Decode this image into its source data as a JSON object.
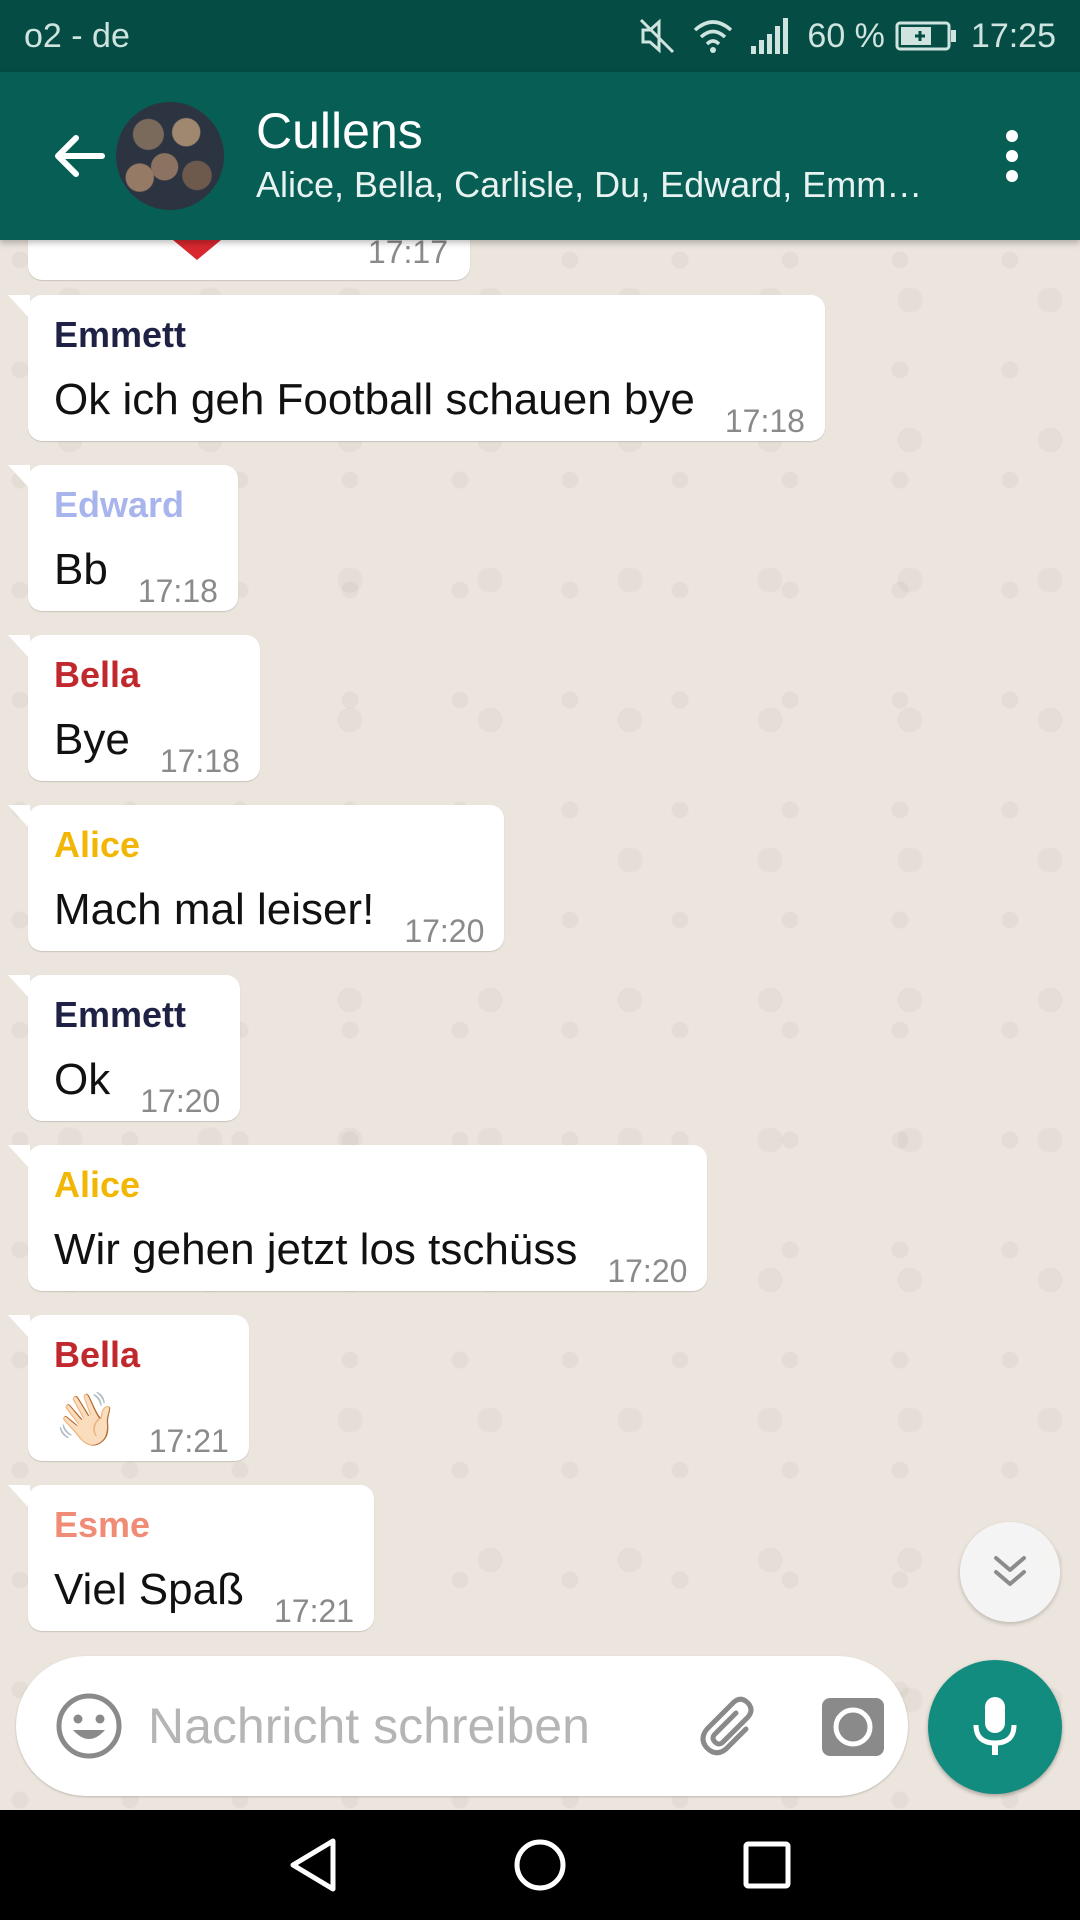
{
  "status_bar": {
    "carrier": "o2 - de",
    "battery": "60 %",
    "time": "17:25"
  },
  "header": {
    "title": "Cullens",
    "members": "Alice, Bella, Carlisle, Du, Edward, Emm…"
  },
  "chat": {
    "partial_time": "17:17",
    "messages": [
      {
        "sender": "Emmett",
        "color": "#1f2244",
        "text": "Ok ich geh Football schauen bye",
        "time": "17:18"
      },
      {
        "sender": "Edward",
        "color": "#a8b4ec",
        "text": "Bb",
        "time": "17:18"
      },
      {
        "sender": "Bella",
        "color": "#c0282e",
        "text": "Bye",
        "time": "17:18"
      },
      {
        "sender": "Alice",
        "color": "#f2b705",
        "text": "Mach mal leiser!",
        "time": "17:20"
      },
      {
        "sender": "Emmett",
        "color": "#1f2244",
        "text": "Ok",
        "time": "17:20"
      },
      {
        "sender": "Alice",
        "color": "#f2b705",
        "text": "Wir gehen jetzt los tschüss",
        "time": "17:20"
      },
      {
        "sender": "Bella",
        "color": "#c0282e",
        "text": "👋🏻",
        "time": "17:21"
      },
      {
        "sender": "Esme",
        "color": "#f08c76",
        "text": "Viel Spaß",
        "time": "17:21"
      }
    ]
  },
  "composer": {
    "placeholder": "Nachricht schreiben"
  },
  "icons": {
    "back": "arrow-left-icon",
    "menu": "more-vert-icon",
    "emoji": "smiley-icon",
    "attach": "paperclip-icon",
    "camera": "camera-icon",
    "mic": "microphone-icon",
    "scroll": "double-chevron-down-icon"
  },
  "colors": {
    "header": "#075e54",
    "statusbar": "#054d44",
    "accent": "#128c7e"
  }
}
